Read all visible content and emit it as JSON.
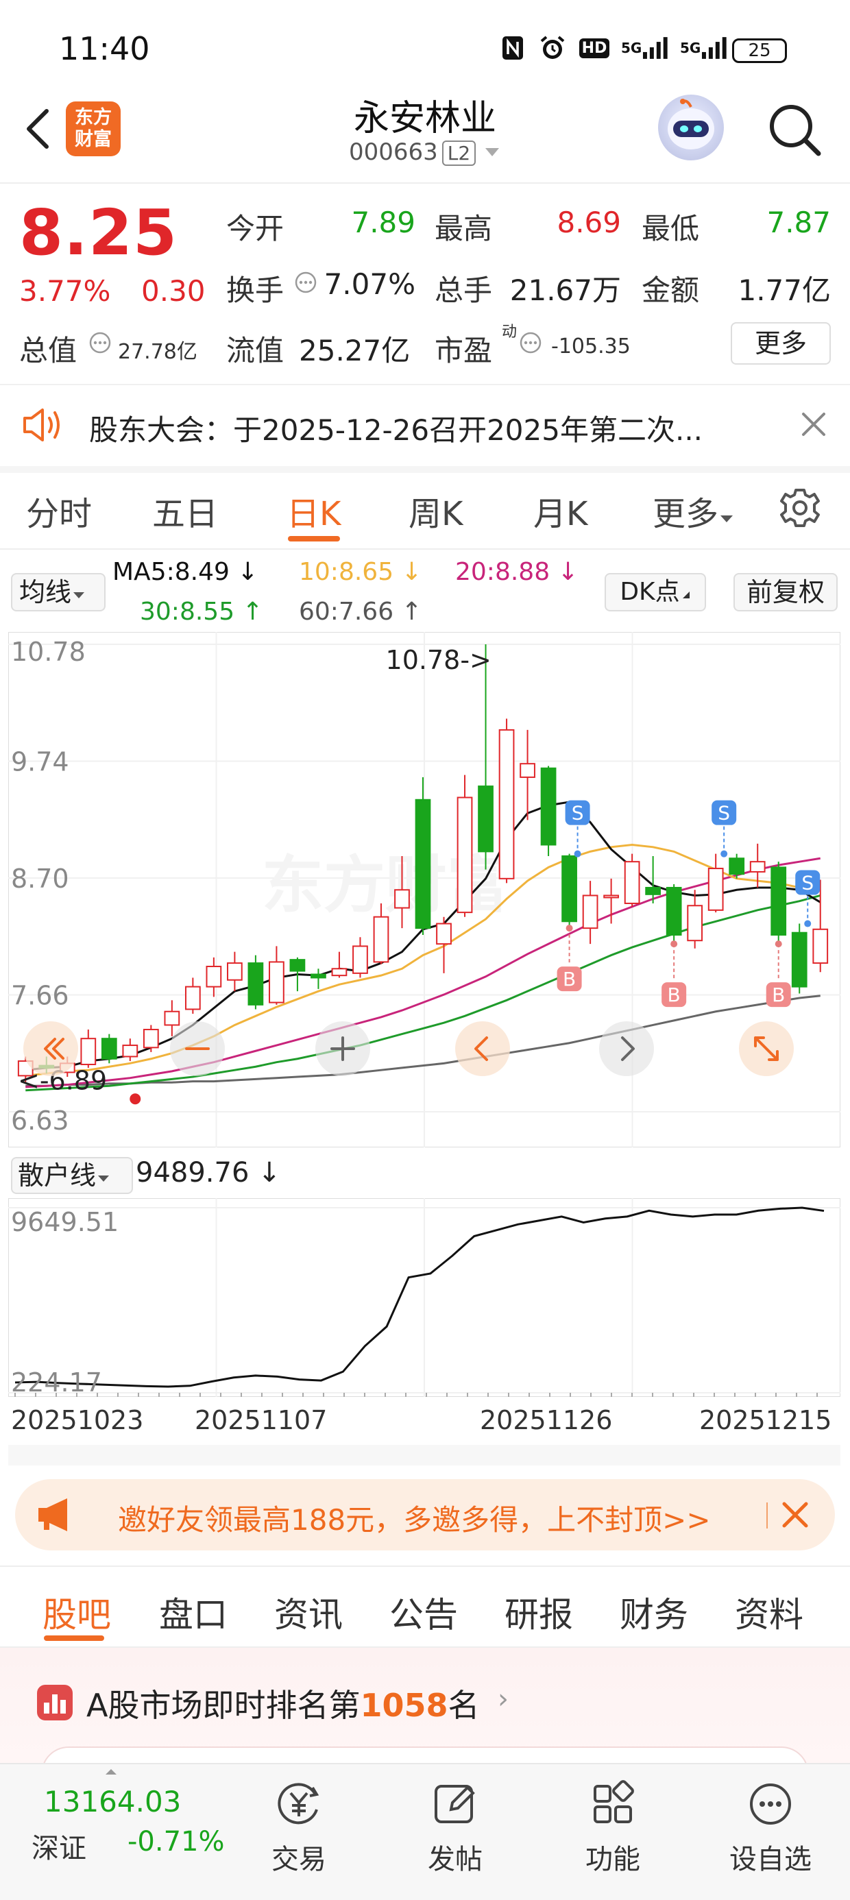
{
  "status_bar": {
    "time": "11:40",
    "battery": "25",
    "icons": [
      "nfc-icon",
      "alarm-icon",
      "hd-icon",
      "signal-5g-icon",
      "signal-5g-icon",
      "battery-icon"
    ],
    "hd_text": "HD",
    "net1": "5G",
    "net2": "5G"
  },
  "header": {
    "title": "永安林业",
    "code": "000663",
    "level_badge": "L2",
    "logo_text": "东方财富"
  },
  "quote": {
    "price": "8.25",
    "change_pct": "3.77%",
    "change": "0.30",
    "open_label": "今开",
    "open": "7.89",
    "high_label": "最高",
    "high": "8.69",
    "low_label": "最低",
    "low": "7.87",
    "turnover_label": "换手",
    "turnover": "7.07%",
    "volume_label": "总手",
    "volume": "21.67万",
    "amount_label": "金额",
    "amount": "1.77亿",
    "mktcap_label": "总值",
    "mktcap": "27.78亿",
    "float_label": "流值",
    "float": "25.27亿",
    "pe_label": "市盈",
    "pe_sup": "动",
    "pe": "-105.35",
    "more_button": "更多"
  },
  "notice": {
    "text": "股东大会：于2025-12-26召开2025年第二次..."
  },
  "chart_tabs": {
    "items": [
      "分时",
      "五日",
      "日K",
      "周K",
      "月K",
      "更多"
    ],
    "active": "日K"
  },
  "ma_row": {
    "select": "均线",
    "ma5": "MA5:8.49",
    "ma10": "10:8.65",
    "ma20": "20:8.88",
    "ma30": "30:8.55",
    "ma60": "60:7.66",
    "dk_button": "DK点",
    "fq_button": "前复权"
  },
  "colors": {
    "up": "#e0262a",
    "down": "#19a51c",
    "ma5": "#111111",
    "ma10": "#f0b33c",
    "ma20": "#c8247a",
    "ma30": "#1e9b2a",
    "ma60": "#666666",
    "accent": "#f06a24"
  },
  "chart_data": [
    {
      "type": "candlestick",
      "y_ticks": [
        "10.78",
        "9.74",
        "8.70",
        "7.66",
        "6.63"
      ],
      "ylim": [
        6.63,
        10.78
      ],
      "annotations": {
        "high_marker": "10.78->",
        "low_marker": "<-6.89"
      },
      "signals": [
        "S",
        "S",
        "S",
        "B",
        "B",
        "B"
      ],
      "candles": [
        {
          "o": 6.95,
          "c": 7.08,
          "h": 7.12,
          "l": 6.89
        },
        {
          "o": 7.04,
          "c": 7.02,
          "h": 7.12,
          "l": 6.97
        },
        {
          "o": 6.98,
          "c": 7.06,
          "h": 7.12,
          "l": 6.94
        },
        {
          "o": 7.05,
          "c": 7.28,
          "h": 7.36,
          "l": 7.02
        },
        {
          "o": 7.28,
          "c": 7.1,
          "h": 7.32,
          "l": 7.06
        },
        {
          "o": 7.12,
          "c": 7.22,
          "h": 7.28,
          "l": 7.08
        },
        {
          "o": 7.2,
          "c": 7.36,
          "h": 7.4,
          "l": 7.16
        },
        {
          "o": 7.4,
          "c": 7.52,
          "h": 7.62,
          "l": 7.3
        },
        {
          "o": 7.54,
          "c": 7.74,
          "h": 7.82,
          "l": 7.5
        },
        {
          "o": 7.74,
          "c": 7.92,
          "h": 8.0,
          "l": 7.65
        },
        {
          "o": 7.8,
          "c": 7.95,
          "h": 8.05,
          "l": 7.7
        },
        {
          "o": 7.95,
          "c": 7.58,
          "h": 8.02,
          "l": 7.54
        },
        {
          "o": 7.6,
          "c": 7.96,
          "h": 8.1,
          "l": 7.58
        },
        {
          "o": 7.98,
          "c": 7.88,
          "h": 8.0,
          "l": 7.7
        },
        {
          "o": 7.85,
          "c": 7.82,
          "h": 7.9,
          "l": 7.72
        },
        {
          "o": 7.84,
          "c": 7.9,
          "h": 8.05,
          "l": 7.82
        },
        {
          "o": 7.86,
          "c": 8.1,
          "h": 8.18,
          "l": 7.82
        },
        {
          "o": 7.96,
          "c": 8.36,
          "h": 8.48,
          "l": 7.94
        },
        {
          "o": 8.44,
          "c": 8.6,
          "h": 8.9,
          "l": 8.26
        },
        {
          "o": 9.4,
          "c": 8.26,
          "h": 9.6,
          "l": 8.2
        },
        {
          "o": 8.12,
          "c": 8.3,
          "h": 8.36,
          "l": 7.86
        },
        {
          "o": 8.4,
          "c": 9.42,
          "h": 9.62,
          "l": 8.36
        },
        {
          "o": 9.52,
          "c": 8.94,
          "h": 10.78,
          "l": 8.78
        },
        {
          "o": 8.7,
          "c": 10.02,
          "h": 10.12,
          "l": 8.66
        },
        {
          "o": 9.6,
          "c": 9.72,
          "h": 10.02,
          "l": 9.22
        },
        {
          "o": 9.68,
          "c": 9.0,
          "h": 9.7,
          "l": 8.9
        },
        {
          "o": 8.9,
          "c": 8.32,
          "h": 8.92,
          "l": 8.26
        },
        {
          "o": 8.26,
          "c": 8.55,
          "h": 8.68,
          "l": 8.12
        },
        {
          "o": 8.55,
          "c": 8.55,
          "h": 8.7,
          "l": 8.3
        },
        {
          "o": 8.48,
          "c": 8.85,
          "h": 8.92,
          "l": 8.45
        },
        {
          "o": 8.62,
          "c": 8.56,
          "h": 8.9,
          "l": 8.48
        },
        {
          "o": 8.62,
          "c": 8.2,
          "h": 8.65,
          "l": 8.12
        },
        {
          "o": 8.15,
          "c": 8.46,
          "h": 8.6,
          "l": 8.08
        },
        {
          "o": 8.42,
          "c": 8.79,
          "h": 8.92,
          "l": 8.4
        },
        {
          "o": 8.88,
          "c": 8.74,
          "h": 8.92,
          "l": 8.7
        },
        {
          "o": 8.76,
          "c": 8.85,
          "h": 9.01,
          "l": 8.62
        },
        {
          "o": 8.8,
          "c": 8.2,
          "h": 8.85,
          "l": 8.12
        },
        {
          "o": 8.22,
          "c": 7.74,
          "h": 8.3,
          "l": 7.68
        },
        {
          "o": 7.95,
          "c": 8.25,
          "h": 8.69,
          "l": 7.87
        }
      ],
      "ma5": [
        7.0,
        7.02,
        7.03,
        7.08,
        7.1,
        7.13,
        7.2,
        7.28,
        7.4,
        7.55,
        7.7,
        7.75,
        7.82,
        7.85,
        7.84,
        7.9,
        7.88,
        7.95,
        8.05,
        8.25,
        8.3,
        8.5,
        8.7,
        9.05,
        9.28,
        9.35,
        9.38,
        9.2,
        8.96,
        8.8,
        8.64,
        8.58,
        8.55,
        8.56,
        8.6,
        8.62,
        8.62,
        8.6,
        8.49
      ],
      "ma10": [
        6.95,
        6.97,
        6.99,
        7.0,
        7.03,
        7.06,
        7.1,
        7.15,
        7.22,
        7.3,
        7.4,
        7.48,
        7.56,
        7.63,
        7.7,
        7.76,
        7.8,
        7.84,
        7.9,
        8.02,
        8.1,
        8.22,
        8.34,
        8.52,
        8.68,
        8.8,
        8.88,
        8.94,
        8.98,
        9.0,
        8.98,
        8.94,
        8.86,
        8.78,
        8.7,
        8.68,
        8.66,
        8.62,
        8.65
      ],
      "ma20": [
        6.85,
        6.86,
        6.87,
        6.89,
        6.91,
        6.93,
        6.96,
        6.99,
        7.03,
        7.07,
        7.12,
        7.17,
        7.22,
        7.27,
        7.32,
        7.37,
        7.42,
        7.47,
        7.53,
        7.6,
        7.67,
        7.75,
        7.83,
        7.93,
        8.03,
        8.12,
        8.21,
        8.3,
        8.38,
        8.45,
        8.52,
        8.58,
        8.63,
        8.68,
        8.73,
        8.78,
        8.82,
        8.85,
        8.88
      ],
      "ma30": [
        6.82,
        6.83,
        6.84,
        6.85,
        6.86,
        6.88,
        6.9,
        6.92,
        6.94,
        6.97,
        7.0,
        7.03,
        7.07,
        7.1,
        7.14,
        7.18,
        7.22,
        7.27,
        7.32,
        7.37,
        7.42,
        7.48,
        7.55,
        7.62,
        7.7,
        7.78,
        7.86,
        7.94,
        8.02,
        8.09,
        8.15,
        8.21,
        8.27,
        8.32,
        8.37,
        8.42,
        8.46,
        8.5,
        8.55
      ],
      "ma60": [
        6.86,
        6.86,
        6.87,
        6.87,
        6.88,
        6.88,
        6.89,
        6.89,
        6.9,
        6.9,
        6.91,
        6.92,
        6.93,
        6.94,
        6.95,
        6.96,
        6.98,
        7.0,
        7.02,
        7.04,
        7.06,
        7.09,
        7.12,
        7.15,
        7.18,
        7.21,
        7.24,
        7.28,
        7.32,
        7.36,
        7.4,
        7.44,
        7.48,
        7.52,
        7.55,
        7.58,
        7.61,
        7.64,
        7.66
      ]
    },
    {
      "type": "line",
      "select": "散户线",
      "value": "9489.76",
      "y_ticks": [
        "9649.51",
        "224.17"
      ],
      "ylim": [
        224.17,
        9649.51
      ],
      "x_ticks": [
        "20251023",
        "20251107",
        "20251126",
        "20251215"
      ],
      "values": [
        750,
        780,
        720,
        680,
        640,
        600,
        560,
        540,
        580,
        800,
        1000,
        1100,
        1050,
        900,
        850,
        1300,
        2600,
        3600,
        6100,
        6300,
        7200,
        8200,
        8500,
        8800,
        9000,
        9200,
        8900,
        9100,
        9200,
        9500,
        9300,
        9200,
        9300,
        9300,
        9500,
        9600,
        9650,
        9489.76
      ]
    }
  ],
  "chart_controls": [
    "double-left-icon",
    "zoom-out-icon",
    "zoom-in-icon",
    "prev-icon",
    "next-icon",
    "expand-icon"
  ],
  "promo": {
    "text": "邀好友领最高188元，多邀多得，上不封顶>>"
  },
  "bottom_tabs": {
    "items": [
      "股吧",
      "盘口",
      "资讯",
      "公告",
      "研报",
      "财务",
      "资料"
    ],
    "active": "股吧"
  },
  "rank": {
    "prefix": "A股市场即时排名第",
    "number": "1058",
    "suffix": "名"
  },
  "bottom_nav": {
    "index_value": "13164.03",
    "index_name": "深证",
    "index_change": "-0.71%",
    "items": [
      "交易",
      "发帖",
      "功能",
      "设自选"
    ]
  }
}
